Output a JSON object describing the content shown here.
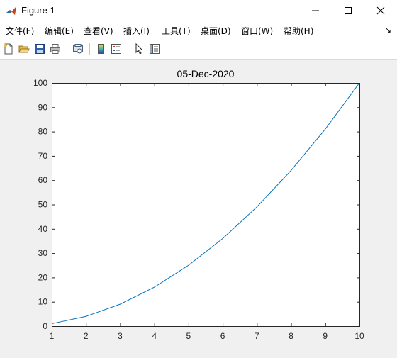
{
  "window": {
    "title": "Figure 1",
    "icon": "matlab-icon"
  },
  "menu": {
    "items": [
      {
        "label": "文件(F)"
      },
      {
        "label": "编辑(E)"
      },
      {
        "label": "查看(V)"
      },
      {
        "label": "插入(I)"
      },
      {
        "label": "工具(T)"
      },
      {
        "label": "桌面(D)"
      },
      {
        "label": "窗口(W)"
      },
      {
        "label": "帮助(H)"
      }
    ],
    "overflow": "↘"
  },
  "toolbar": {
    "buttons": [
      "new-figure-icon",
      "open-file-icon",
      "save-icon",
      "print-icon",
      "print-preview-icon",
      "colorbar-icon",
      "legend-icon",
      "pointer-icon",
      "property-editor-icon"
    ]
  },
  "chart_data": {
    "type": "line",
    "title": "05-Dec-2020",
    "xlabel": "",
    "ylabel": "",
    "x": [
      1,
      2,
      3,
      4,
      5,
      6,
      7,
      8,
      9,
      10
    ],
    "y": [
      1,
      4,
      9,
      16,
      25,
      36,
      49,
      64,
      81,
      100
    ],
    "xlim": [
      1,
      10
    ],
    "ylim": [
      0,
      100
    ],
    "xticks": [
      "1",
      "2",
      "3",
      "4",
      "5",
      "6",
      "7",
      "8",
      "9",
      "10"
    ],
    "yticks": [
      "0",
      "10",
      "20",
      "30",
      "40",
      "50",
      "60",
      "70",
      "80",
      "90",
      "100"
    ],
    "line_color": "#0072bd",
    "grid": false
  }
}
